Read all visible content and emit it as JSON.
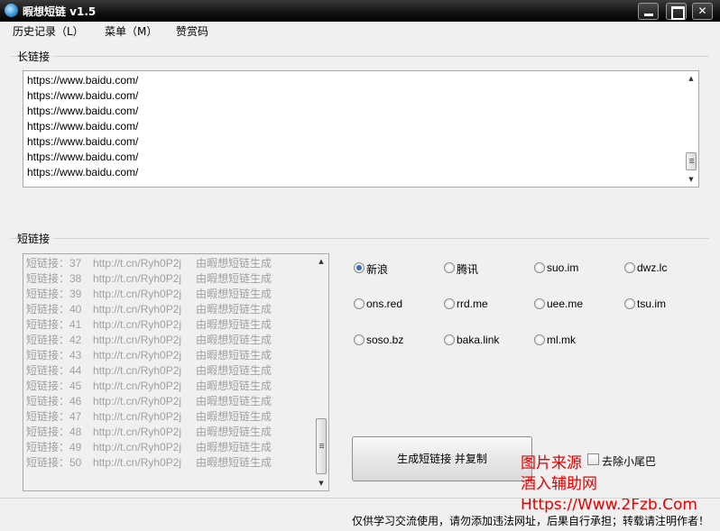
{
  "window": {
    "title": "暇想短链 v1.5"
  },
  "menu": {
    "history": "历史记录（L）",
    "menu": "菜单（M）",
    "reward": "赞赏码"
  },
  "long_group": {
    "label": "长链接",
    "lines": [
      "https://www.baidu.com/",
      "https://www.baidu.com/",
      "https://www.baidu.com/",
      "https://www.baidu.com/",
      "https://www.baidu.com/",
      "https://www.baidu.com/",
      "https://www.baidu.com/"
    ]
  },
  "short_group": {
    "label": "短链接",
    "rows": [
      {
        "prefix": "短链接：37",
        "url": "http://t.cn/Ryh0P2j",
        "suffix": "由暇想短链生成"
      },
      {
        "prefix": "短链接：38",
        "url": "http://t.cn/Ryh0P2j",
        "suffix": "由暇想短链生成"
      },
      {
        "prefix": "短链接：39",
        "url": "http://t.cn/Ryh0P2j",
        "suffix": "由暇想短链生成"
      },
      {
        "prefix": "短链接：40",
        "url": "http://t.cn/Ryh0P2j",
        "suffix": "由暇想短链生成"
      },
      {
        "prefix": "短链接：41",
        "url": "http://t.cn/Ryh0P2j",
        "suffix": "由暇想短链生成"
      },
      {
        "prefix": "短链接：42",
        "url": "http://t.cn/Ryh0P2j",
        "suffix": "由暇想短链生成"
      },
      {
        "prefix": "短链接：43",
        "url": "http://t.cn/Ryh0P2j",
        "suffix": "由暇想短链生成"
      },
      {
        "prefix": "短链接：44",
        "url": "http://t.cn/Ryh0P2j",
        "suffix": "由暇想短链生成"
      },
      {
        "prefix": "短链接：45",
        "url": "http://t.cn/Ryh0P2j",
        "suffix": "由暇想短链生成"
      },
      {
        "prefix": "短链接：46",
        "url": "http://t.cn/Ryh0P2j",
        "suffix": "由暇想短链生成"
      },
      {
        "prefix": "短链接：47",
        "url": "http://t.cn/Ryh0P2j",
        "suffix": "由暇想短链生成"
      },
      {
        "prefix": "短链接：48",
        "url": "http://t.cn/Ryh0P2j",
        "suffix": "由暇想短链生成"
      },
      {
        "prefix": "短链接：49",
        "url": "http://t.cn/Ryh0P2j",
        "suffix": "由暇想短链生成"
      },
      {
        "prefix": "短链接：50",
        "url": "http://t.cn/Ryh0P2j",
        "suffix": "由暇想短链生成"
      }
    ]
  },
  "services": [
    {
      "label": "新浪",
      "selected": true
    },
    {
      "label": "腾讯",
      "selected": false
    },
    {
      "label": "suo.im",
      "selected": false
    },
    {
      "label": "dwz.lc",
      "selected": false
    },
    {
      "label": "ons.red",
      "selected": false
    },
    {
      "label": "rrd.me",
      "selected": false
    },
    {
      "label": "uee.me",
      "selected": false
    },
    {
      "label": "tsu.im",
      "selected": false
    },
    {
      "label": "soso.bz",
      "selected": false
    },
    {
      "label": "baka.link",
      "selected": false
    },
    {
      "label": "ml.mk",
      "selected": false
    }
  ],
  "actions": {
    "generate_label": "生成短链接 并复制",
    "remove_tail_label": "去除小尾巴",
    "remove_tail_checked": false
  },
  "watermark": {
    "line1": "图片来源",
    "line2": "酒入辅助网",
    "line3": "Https://Www.2Fzb.Com"
  },
  "footer": {
    "notice": "仅供学习交流使用，请勿添加违法网址，后果自行承担；转载请注明作者！"
  },
  "colors": {
    "watermark": "#e60000",
    "radio_selected": "#3a6fb5",
    "short_text": "#a0a0a0"
  }
}
